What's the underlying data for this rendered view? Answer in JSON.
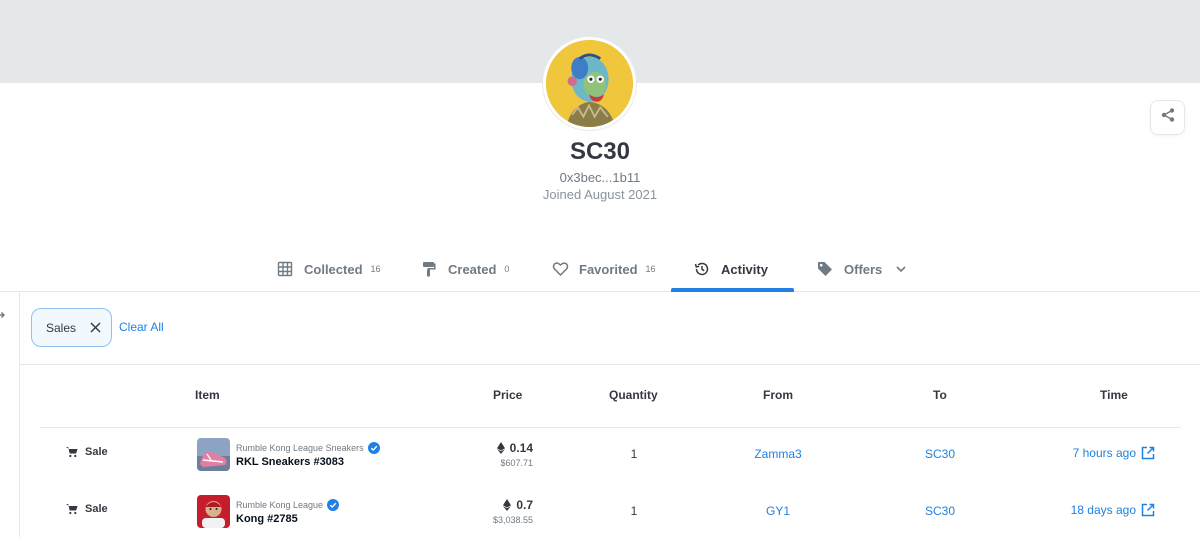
{
  "profile": {
    "username": "SC30",
    "address": "0x3bec...1b11",
    "joined": "Joined August 2021"
  },
  "tabs": [
    {
      "label": "Collected",
      "count": "16",
      "icon": "grid-icon"
    },
    {
      "label": "Created",
      "count": "0",
      "icon": "paintbrush-icon"
    },
    {
      "label": "Favorited",
      "count": "16",
      "icon": "heart-icon"
    },
    {
      "label": "Activity",
      "count": "",
      "icon": "history-icon",
      "active": true
    },
    {
      "label": "Offers",
      "count": "",
      "icon": "tag-icon"
    }
  ],
  "filters": {
    "chip_label": "Sales",
    "clear_label": "Clear All"
  },
  "table": {
    "headers": {
      "item": "Item",
      "price": "Price",
      "quantity": "Quantity",
      "from": "From",
      "to": "To",
      "time": "Time"
    },
    "rows": [
      {
        "event": "Sale",
        "collection": "Rumble Kong League Sneakers",
        "item": "RKL Sneakers #3083",
        "price": "0.14",
        "usd": "$607.71",
        "quantity": "1",
        "from": "Zamma3",
        "to": "SC30",
        "time": "7 hours ago"
      },
      {
        "event": "Sale",
        "collection": "Rumble Kong League",
        "item": "Kong #2785",
        "price": "0.7",
        "usd": "$3,038.55",
        "quantity": "1",
        "from": "GY1",
        "to": "SC30",
        "time": "18 days ago"
      }
    ]
  },
  "colors": {
    "accent": "#2081e2",
    "banner": "#e5e8eb",
    "avatar_bg": "#f0c63c"
  }
}
